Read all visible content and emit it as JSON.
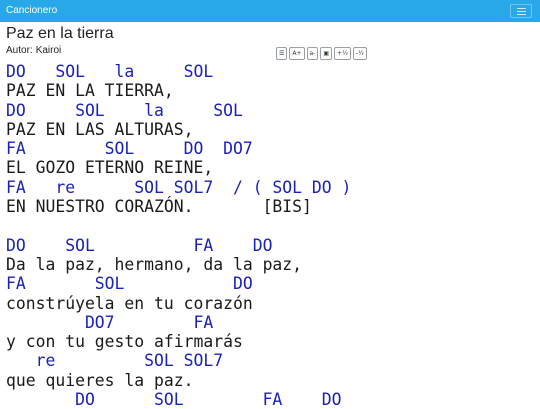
{
  "navbar": {
    "brand": "Cancionero",
    "menu_icon": "hamburger-menu-icon"
  },
  "song": {
    "title": "Paz en la tierra",
    "author_label": "Autor:",
    "author": "Kairoi"
  },
  "toolbar": {
    "buttons": [
      {
        "label": "☰",
        "icon": "list-icon"
      },
      {
        "label": "A+",
        "icon": "font-increase-icon"
      },
      {
        "label": "a-",
        "icon": "font-decrease-icon"
      },
      {
        "label": "▣",
        "icon": "columns-icon"
      },
      {
        "label": "+½",
        "icon": "transpose-up-icon"
      },
      {
        "label": "-½",
        "icon": "transpose-down-icon"
      }
    ]
  },
  "colors": {
    "navbar": "#28a8e8",
    "chord": "#1a22bb",
    "lyric": "#1a1a1a"
  },
  "lines": [
    {
      "type": "chord",
      "text": "DO   SOL   la     SOL"
    },
    {
      "type": "lyric",
      "text": "PAZ EN LA TIERRA,"
    },
    {
      "type": "chord",
      "text": "DO     SOL    la     SOL"
    },
    {
      "type": "lyric",
      "text": "PAZ EN LAS ALTURAS,"
    },
    {
      "type": "chord",
      "text": "FA        SOL     DO  DO7"
    },
    {
      "type": "lyric",
      "text": "EL GOZO ETERNO REINE,"
    },
    {
      "type": "chord",
      "text": "FA   re      SOL SOL7  / ( SOL DO )"
    },
    {
      "type": "lyric",
      "text": "EN NUESTRO CORAZÓN.       [BIS]"
    },
    {
      "type": "blank",
      "text": ""
    },
    {
      "type": "chord",
      "text": "DO    SOL          FA    DO"
    },
    {
      "type": "lyric",
      "text": "Da la paz, hermano, da la paz,"
    },
    {
      "type": "chord",
      "text": "FA       SOL           DO"
    },
    {
      "type": "lyric",
      "text": "constrúyela en tu corazón"
    },
    {
      "type": "chord",
      "text": "        DO7        FA"
    },
    {
      "type": "lyric",
      "text": "y con tu gesto afirmarás"
    },
    {
      "type": "chord",
      "text": "   re         SOL SOL7"
    },
    {
      "type": "lyric",
      "text": "que quieres la paz."
    },
    {
      "type": "chord",
      "text": "       DO      SOL        FA    DO"
    }
  ]
}
